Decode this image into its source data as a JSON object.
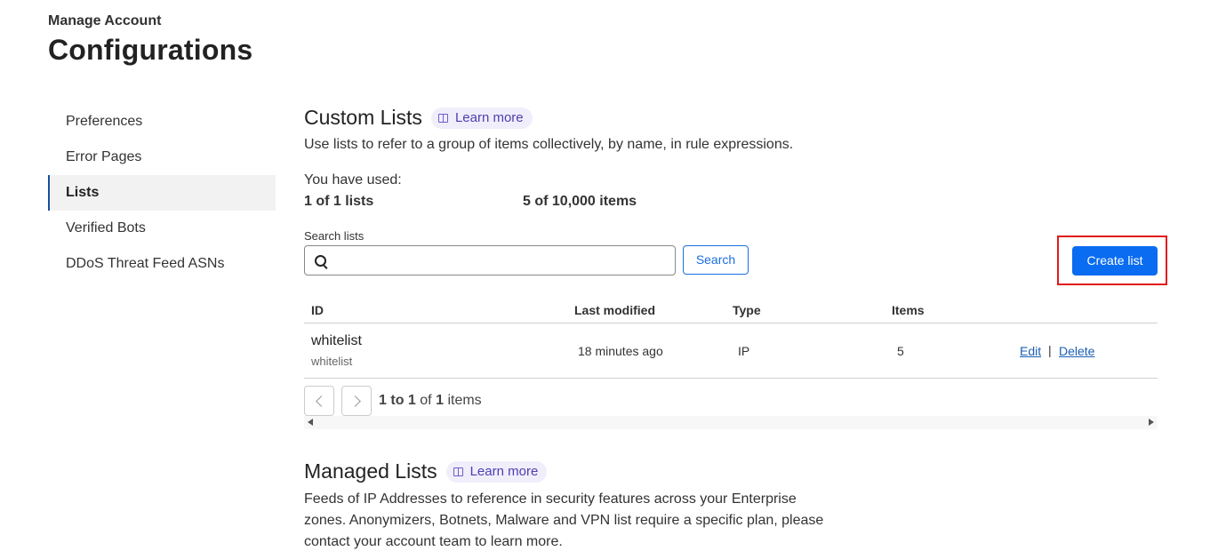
{
  "header": {
    "subtitle": "Manage Account",
    "title": "Configurations"
  },
  "sidebar": {
    "items": [
      {
        "label": "Preferences",
        "active": false
      },
      {
        "label": "Error Pages",
        "active": false
      },
      {
        "label": "Lists",
        "active": true
      },
      {
        "label": "Verified Bots",
        "active": false
      },
      {
        "label": "DDoS Threat Feed ASNs",
        "active": false
      }
    ]
  },
  "custom_lists": {
    "title": "Custom Lists",
    "learn_more": "Learn more",
    "description": "Use lists to refer to a group of items collectively, by name, in rule expressions.",
    "usage_label": "You have used:",
    "lists_used": "1 of 1 lists",
    "items_used": "5 of 10,000 items",
    "search_label": "Search lists",
    "search_value": "",
    "search_button": "Search",
    "create_button": "Create list",
    "table": {
      "columns": [
        "ID",
        "Last modified",
        "Type",
        "Items"
      ],
      "rows": [
        {
          "id": "whitelist",
          "name": "whitelist",
          "last_modified": "18 minutes ago",
          "type": "IP",
          "items": "5",
          "edit": "Edit",
          "separator": "|",
          "delete": "Delete"
        }
      ]
    },
    "pagination": {
      "from": "1",
      "to_word": "to",
      "to": "1",
      "of_word": "of",
      "total": "1",
      "unit": "items"
    }
  },
  "managed_lists": {
    "title": "Managed Lists",
    "learn_more": "Learn more",
    "description_lines": [
      "Feeds of IP Addresses to reference in security features across your Enterprise",
      "zones. Anonymizers, Botnets, Malware and VPN list require a specific plan, please",
      "contact your account team to learn more."
    ]
  },
  "colors": {
    "primary": "#0a6cf0",
    "highlight": "#e21b1b",
    "link": "#1a5fb4"
  }
}
